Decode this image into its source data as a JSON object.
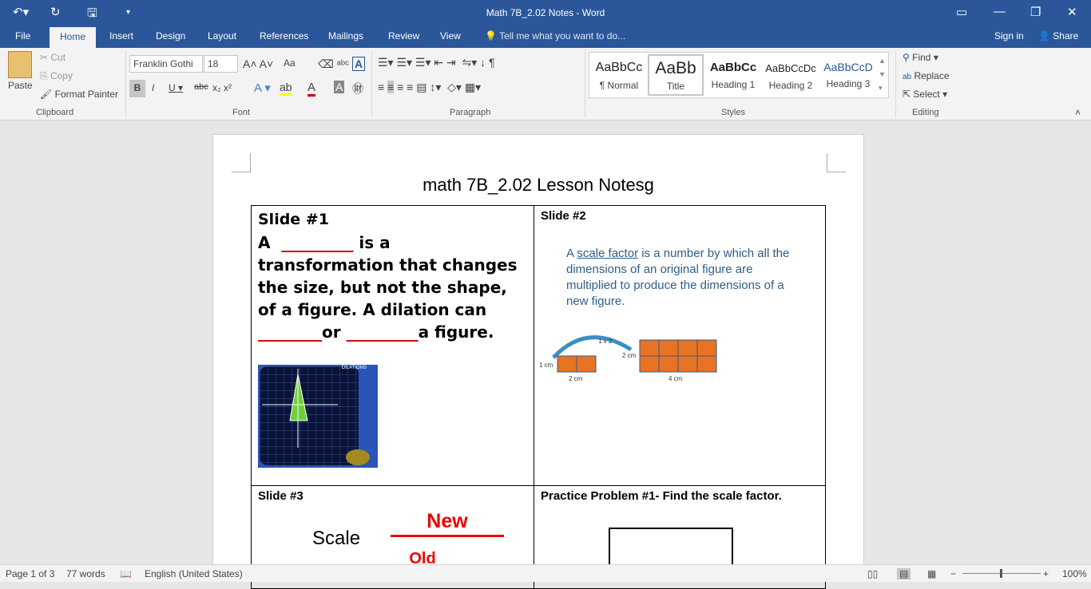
{
  "window": {
    "title": "Math 7B_2.02 Notes - Word"
  },
  "tabs": [
    "File",
    "Home",
    "Insert",
    "Design",
    "Layout",
    "References",
    "Mailings",
    "Review",
    "View"
  ],
  "tell_me": "Tell me what you want to do...",
  "sign_in": "Sign in",
  "share": "Share",
  "clipboard": {
    "paste": "Paste",
    "cut": "Cut",
    "copy": "Copy",
    "format_painter": "Format Painter",
    "label": "Clipboard"
  },
  "font": {
    "name": "Franklin Gothi",
    "size": "18",
    "label": "Font",
    "change_case": "Aa"
  },
  "paragraph": {
    "label": "Paragraph"
  },
  "styles": {
    "label": "Styles",
    "items": [
      {
        "preview": "AaBbCc",
        "name": "¶ Normal"
      },
      {
        "preview": "AaBb",
        "name": "Title"
      },
      {
        "preview": "AaBbCc",
        "name": "Heading 1"
      },
      {
        "preview": "AaBbCcDc",
        "name": "Heading 2"
      },
      {
        "preview": "AaBbCcD",
        "name": "Heading 3"
      }
    ]
  },
  "editing": {
    "find": "Find",
    "replace": "Replace",
    "select": "Select",
    "label": "Editing"
  },
  "document": {
    "title": "math 7B_2.02 Lesson Notesg",
    "slide1": {
      "heading": "Slide #1",
      "text_a": "A",
      "blank1": "_________",
      "text_b": "is a transformation that changes the size, but not the shape, of a figure. A dilation can",
      "blank2": "________",
      "text_c": "or",
      "blank3": "_________",
      "text_d": "a figure.",
      "image_label": "DILATIONS"
    },
    "slide2": {
      "heading": "Slide #2",
      "definition_pre": "A",
      "definition_term": "scale factor",
      "definition_post": "is a number by which all the dimensions of an original figure are multiplied to produce the dimensions of a new figure.",
      "mult": "1 x 2",
      "small_h": "1 cm",
      "small_w": "2 cm",
      "big_h": "2 cm",
      "big_w": "4 cm"
    },
    "slide3": {
      "heading": "Slide #3",
      "scale": "Scale",
      "new": "New",
      "old": "Old"
    },
    "practice": {
      "heading": "Practice Problem #1- Find the scale factor."
    }
  },
  "status": {
    "page": "Page 1 of 3",
    "words": "77 words",
    "language": "English (United States)",
    "zoom": "100%"
  }
}
